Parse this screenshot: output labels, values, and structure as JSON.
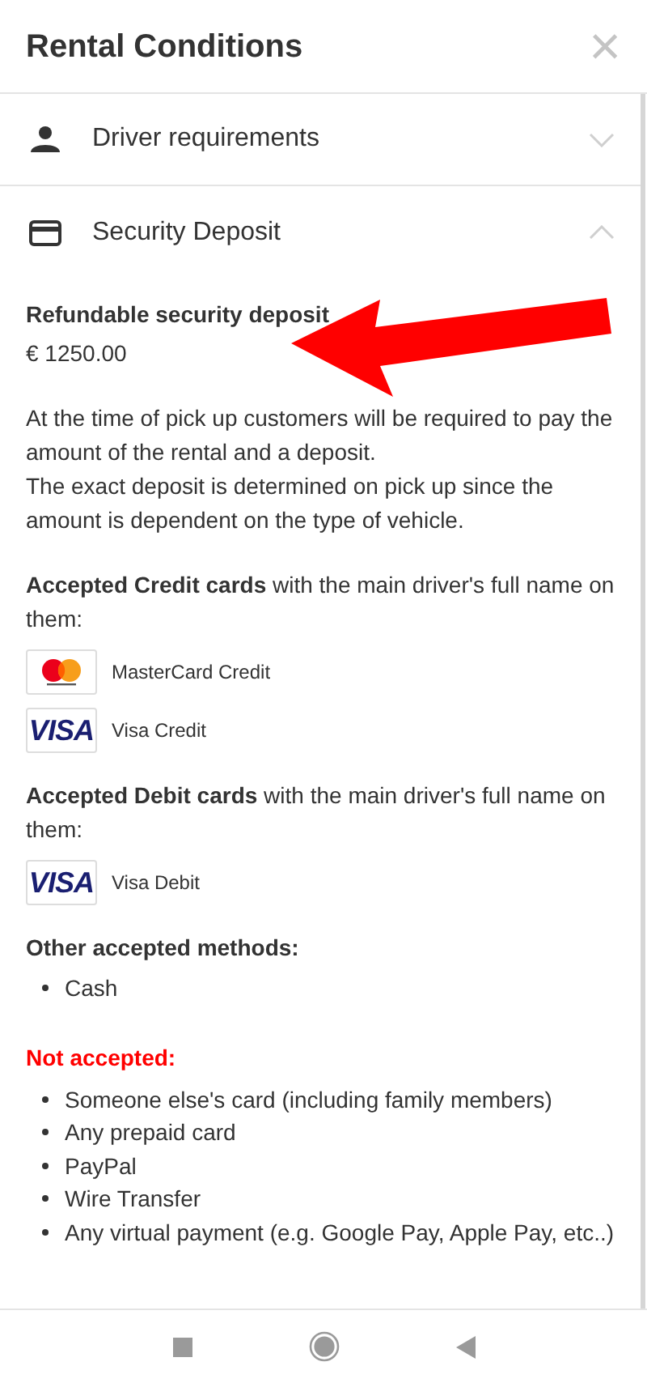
{
  "dialog": {
    "title": "Rental Conditions",
    "close": "×"
  },
  "sections": [
    {
      "title": "Driver requirements",
      "kind": "person",
      "expanded": false
    },
    {
      "title": "Security Deposit",
      "kind": "card",
      "expanded": true
    }
  ],
  "deposit": {
    "label": "Refundable security deposit",
    "amount": "€ 1250.00",
    "paragraph": [
      "At the time of pick up customers will be required to pay the amount of the rental and a deposit.",
      "The exact deposit is determined on pick up since the amount is dependent on the type of vehicle."
    ]
  },
  "credit": {
    "text": "**Accepted Credit cards** with the main driver's full name on them:",
    "cards": [
      {
        "kind": "mastercard",
        "name": "MasterCard Credit"
      },
      {
        "kind": "visa",
        "logo_text": "VISA",
        "name": "Visa Credit"
      }
    ]
  },
  "debit": {
    "text": "**Accepted Debit cards** with the main driver's full name on them:",
    "cards": [
      {
        "kind": "visa",
        "logo_text": "VISA",
        "name": "Visa Debit"
      }
    ]
  },
  "other": {
    "title": "Other accepted methods:",
    "items": [
      "Cash"
    ]
  },
  "not_accepted": {
    "title": "Not accepted:",
    "items": [
      "Someone else's card (including family members)",
      "Any prepaid card",
      "PayPal",
      "Wire Transfer",
      "Any virtual payment (e.g. Google Pay, Apple Pay, etc..)"
    ]
  },
  "annotations": [
    {
      "kind": "arrow",
      "color": "#ff0000"
    }
  ]
}
